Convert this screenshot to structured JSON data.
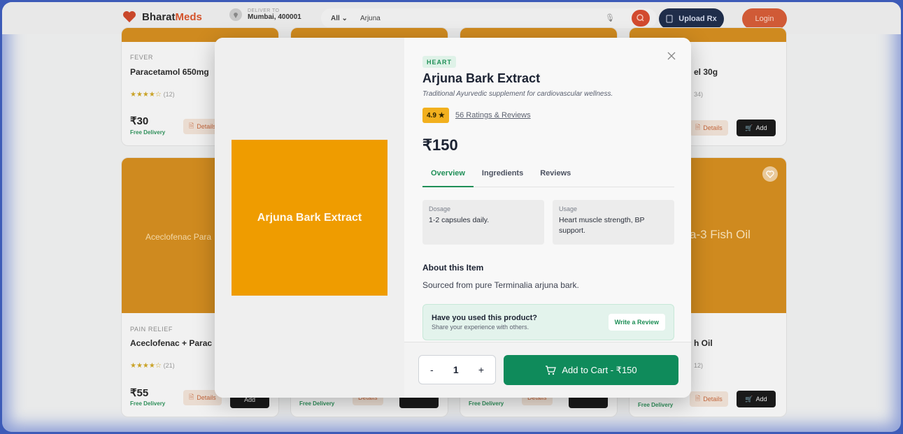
{
  "header": {
    "brand_part1": "Bharat",
    "brand_part2": "Meds",
    "deliver_label": "DELIVER TO",
    "deliver_location": "Mumbai, 400001",
    "search_category": "All",
    "search_query": "Arjuna",
    "upload_label": "Upload Rx",
    "login_label": "Login"
  },
  "background_cards": [
    {
      "category": "FEVER",
      "name": "Paracetamol 650mg",
      "rating_count": "(12)",
      "price": "₹30",
      "delivery": "Free Delivery",
      "details": "Details"
    },
    {
      "name_fragment": "el 30g",
      "rating_count": "34)",
      "details": "Details",
      "add": "Add"
    },
    {
      "image_label": "Aceclofenac  Para",
      "category": "PAIN RELIEF",
      "name": "Aceclofenac + Parac",
      "rating_count": "(21)",
      "price": "₹55",
      "delivery": "Free Delivery",
      "details": "Details",
      "add": "Add"
    },
    {
      "image_label": "a-3 Fish Oil",
      "name_fragment": "h Oil",
      "rating_count": "12)",
      "delivery": "Free Delivery",
      "details": "Details",
      "add": "Add"
    },
    {
      "delivery": "Free Delivery",
      "details": "Details"
    },
    {
      "delivery": "Free Delivery",
      "details": "Details"
    }
  ],
  "modal": {
    "image_label": "Arjuna Bark Extract",
    "tag": "HEART",
    "title": "Arjuna Bark Extract",
    "subtitle": "Traditional Ayurvedic supplement for cardiovascular wellness.",
    "rating": "4.9",
    "reviews_link": "56 Ratings & Reviews",
    "price": "₹150",
    "tabs": [
      {
        "label": "Overview",
        "active": true
      },
      {
        "label": "Ingredients",
        "active": false
      },
      {
        "label": "Reviews",
        "active": false
      }
    ],
    "dosage_label": "Dosage",
    "dosage_value": "1-2 capsules daily.",
    "usage_label": "Usage",
    "usage_value": "Heart muscle strength, BP support.",
    "about_heading": "About this Item",
    "about_text": "Sourced from pure Terminalia arjuna bark.",
    "review_prompt": "Have you used this product?",
    "review_sub": "Share your experience with others.",
    "review_button": "Write a Review",
    "qty_minus": "-",
    "qty_value": "1",
    "qty_plus": "+",
    "add_to_cart": "Add to Cart - ₹150"
  },
  "colors": {
    "brand_accent": "#d4532b",
    "product_image": "#ef9c00",
    "primary_green": "#0f8b5b",
    "rating_badge": "#f2b01e"
  }
}
